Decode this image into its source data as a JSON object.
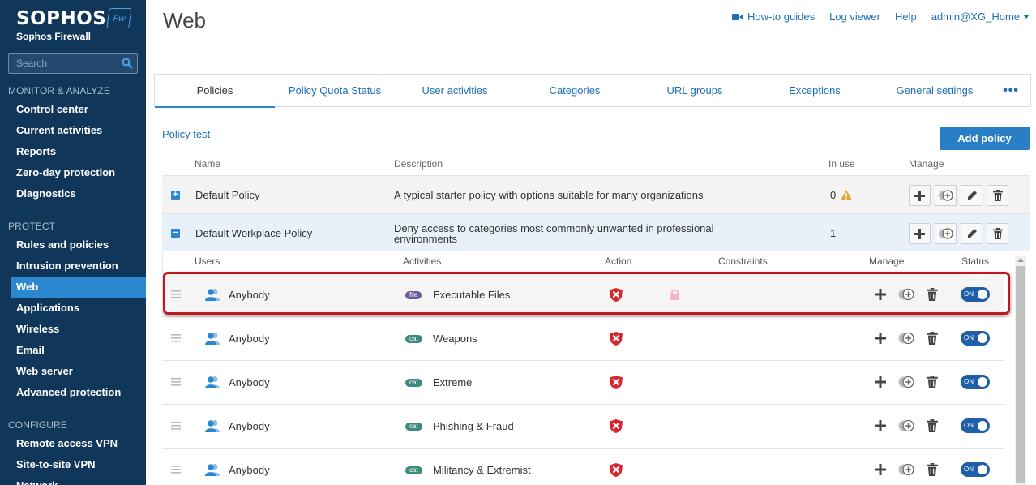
{
  "sidebar": {
    "brand": "SOPHOS",
    "badge": "Fw",
    "product": "Sophos Firewall",
    "search_placeholder": "Search",
    "sections": [
      {
        "title": "MONITOR & ANALYZE",
        "items": [
          "Control center",
          "Current activities",
          "Reports",
          "Zero-day protection",
          "Diagnostics"
        ]
      },
      {
        "title": "PROTECT",
        "items": [
          "Rules and policies",
          "Intrusion prevention",
          "Web",
          "Applications",
          "Wireless",
          "Email",
          "Web server",
          "Advanced protection"
        ]
      },
      {
        "title": "CONFIGURE",
        "items": [
          "Remote access VPN",
          "Site-to-site VPN",
          "Network"
        ]
      }
    ],
    "active_item": "Web"
  },
  "header": {
    "title": "Web",
    "links": [
      "How-to guides",
      "Log viewer",
      "Help",
      "admin@XG_Home"
    ]
  },
  "tabs": [
    "Policies",
    "Policy Quota Status",
    "User activities",
    "Categories",
    "URL groups",
    "Exceptions",
    "General settings"
  ],
  "more_label": "•••",
  "policy_test_link": "Policy test",
  "add_policy_label": "Add policy",
  "policy_columns": {
    "name": "Name",
    "description": "Description",
    "in_use": "In use",
    "manage": "Manage"
  },
  "policies": [
    {
      "expander": "+",
      "name": "Default Policy",
      "description": "A typical starter policy with options suitable for many organizations",
      "in_use": "0",
      "warning": true
    },
    {
      "expander": "−",
      "name": "Default Workplace Policy",
      "description": "Deny access to categories most commonly unwanted in professional environments",
      "in_use": "1",
      "warning": false
    }
  ],
  "rule_columns": {
    "users": "Users",
    "activities": "Activities",
    "action": "Action",
    "constraints": "Constraints",
    "manage": "Manage",
    "status": "Status"
  },
  "rules": [
    {
      "user": "Anybody",
      "tag": "file",
      "activity": "Executable Files",
      "action": "deny",
      "constraint": "lock",
      "status": "ON"
    },
    {
      "user": "Anybody",
      "tag": "cat",
      "activity": "Weapons",
      "action": "deny",
      "status": "ON"
    },
    {
      "user": "Anybody",
      "tag": "cat",
      "activity": "Extreme",
      "action": "deny",
      "status": "ON"
    },
    {
      "user": "Anybody",
      "tag": "cat",
      "activity": "Phishing & Fraud",
      "action": "deny",
      "status": "ON"
    },
    {
      "user": "Anybody",
      "tag": "cat",
      "activity": "Militancy & Extremist",
      "action": "deny",
      "status": "ON"
    }
  ],
  "colors": {
    "sidebar": "#10365a",
    "accent": "#2a87d0",
    "link": "#1c6fb7",
    "deny": "#d9262e",
    "highlight": "#c0161e"
  }
}
